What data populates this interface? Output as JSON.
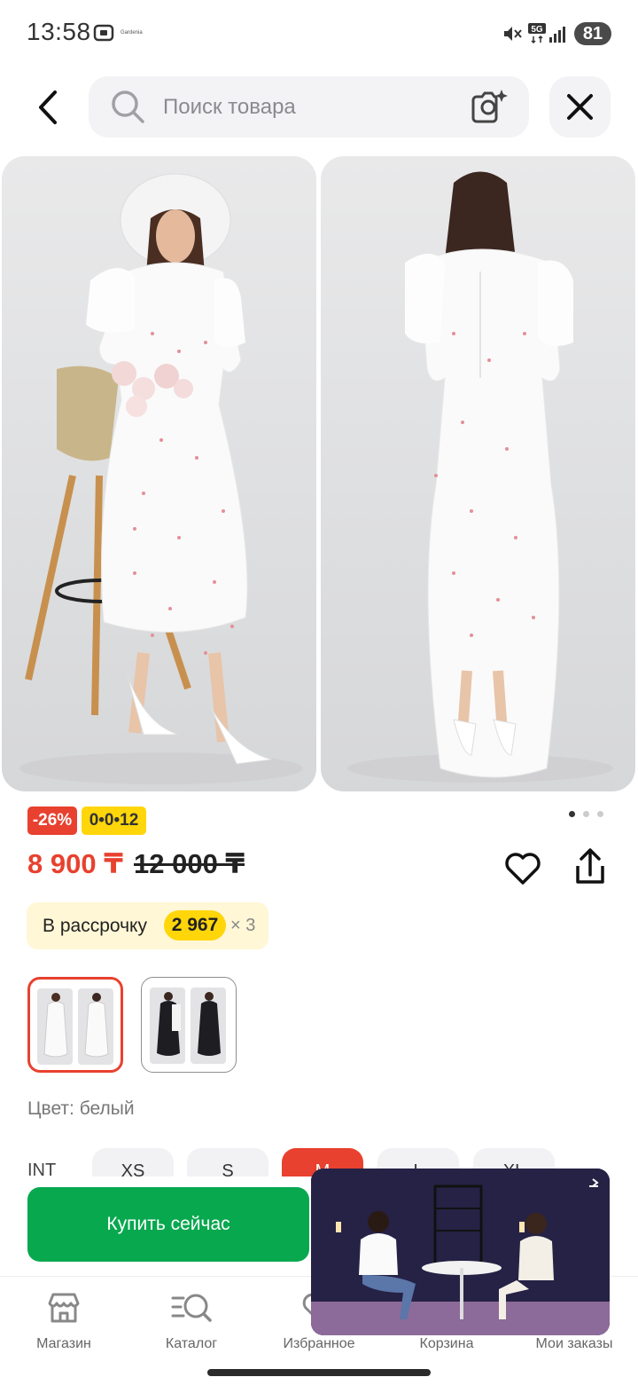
{
  "status_bar": {
    "time": "13:58",
    "battery": "81",
    "network": "5G"
  },
  "search": {
    "placeholder": "Поиск товара"
  },
  "product": {
    "discount_badge": "-26%",
    "installment_badge": "0•0•12",
    "price": "8 900 ₸",
    "old_price": "12 000 ₸",
    "installment": {
      "label": "В рассрочку",
      "amount": "2 967",
      "multiplier": "× 3"
    },
    "color_label": "Цвет: белый",
    "sizes": {
      "label": "INT",
      "options": [
        "XS",
        "S",
        "M",
        "L",
        "XL"
      ],
      "selected": "M"
    },
    "image_count": 3,
    "current_image": 1
  },
  "buy_button": "Купить сейчас",
  "colors": {
    "accent": "#e8412f",
    "green": "#08a84f",
    "yellow": "#ffd60a"
  },
  "bottom_nav": [
    {
      "label": "Магазин",
      "icon": "store-icon"
    },
    {
      "label": "Каталог",
      "icon": "catalog-search-icon"
    },
    {
      "label": "Избранное",
      "icon": "heart-icon"
    },
    {
      "label": "Корзина",
      "icon": "cart-icon"
    },
    {
      "label": "Мои заказы",
      "icon": "orders-icon"
    }
  ]
}
